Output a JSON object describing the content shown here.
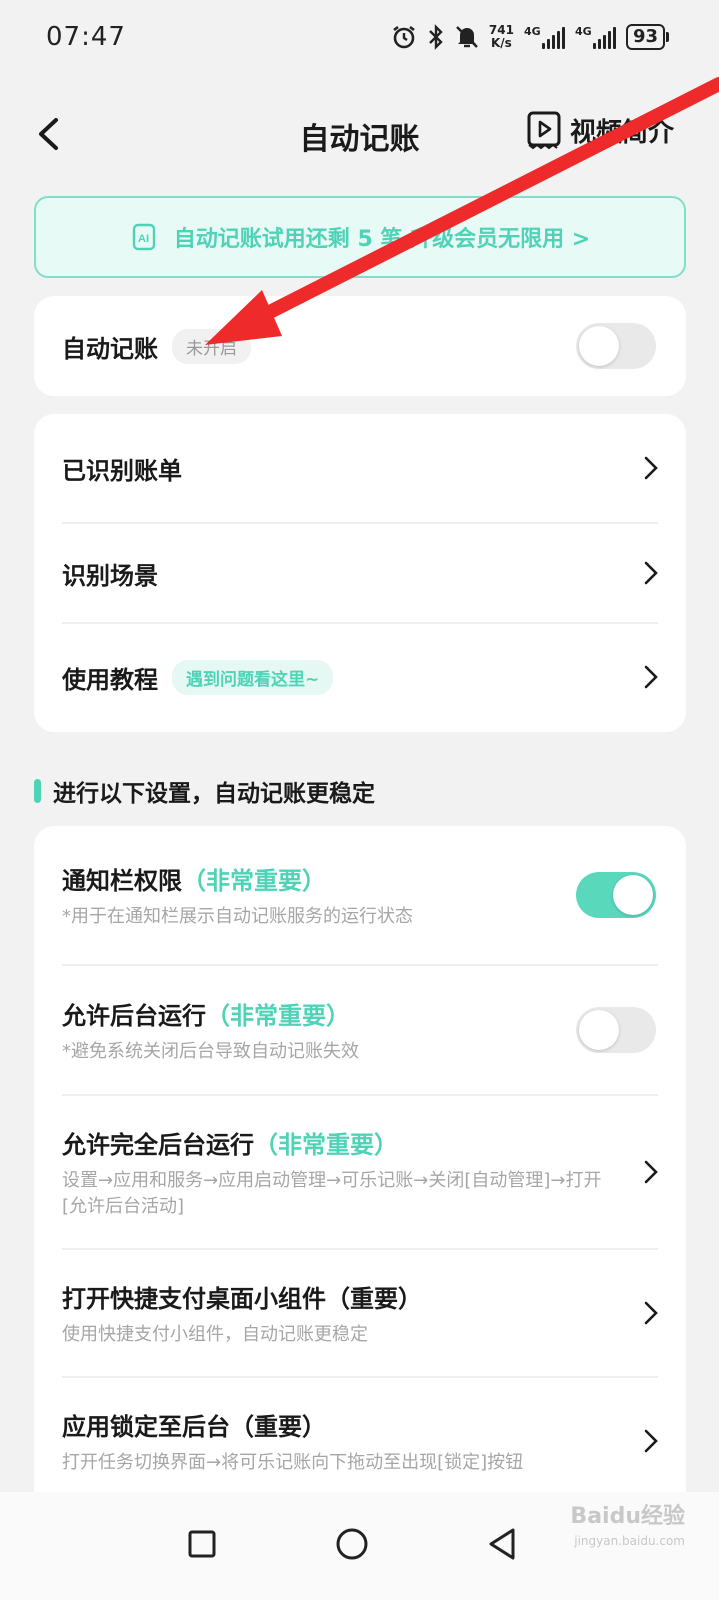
{
  "status_bar": {
    "time": "07:47",
    "net_speed_value": "741",
    "net_speed_unit": "K/s",
    "sim1_label": "4G",
    "sim2_label": "4G",
    "battery": "93",
    "icons": [
      "alarm-icon",
      "bluetooth-icon",
      "mute-icon",
      "signal-icon",
      "battery-icon"
    ]
  },
  "header": {
    "title": "自动记账",
    "video_intro_label": "视频简介"
  },
  "promo": {
    "text": "自动记账试用还剩 5 笔 升级会员无限用 >"
  },
  "auto_card": {
    "title": "自动记账",
    "status_badge": "未开启",
    "toggle_on": false
  },
  "menu": {
    "items": [
      {
        "label": "已识别账单"
      },
      {
        "label": "识别场景"
      },
      {
        "label": "使用教程",
        "badge": "遇到问题看这里~"
      }
    ]
  },
  "section": {
    "title": "进行以下设置，自动记账更稳定"
  },
  "settings": {
    "items": [
      {
        "title": "通知栏权限",
        "importance": "（非常重要）",
        "desc": "*用于在通知栏展示自动记账服务的运行状态",
        "toggle_on": true
      },
      {
        "title": "允许后台运行",
        "importance": "（非常重要）",
        "desc": "*避免系统关闭后台导致自动记账失效",
        "toggle_on": false
      },
      {
        "title": "允许完全后台运行",
        "importance": "（非常重要）",
        "desc": "设置→应用和服务→应用启动管理→可乐记账→关闭[自动管理]→打开[允许后台活动]"
      },
      {
        "title": "打开快捷支付桌面小组件（重要）",
        "desc": "使用快捷支付小组件，自动记账更稳定"
      },
      {
        "title": "应用锁定至后台（重要）",
        "desc": "打开任务切换界面→将可乐记账向下拖动至出现[锁定]按钮"
      }
    ]
  },
  "watermark": {
    "text": "Baidu经验",
    "sub": "jingyan.baidu.com"
  },
  "colors": {
    "accent": "#4fd3b7",
    "toggle_on": "#59d8bb",
    "annotation_arrow": "#ee2a2a"
  }
}
